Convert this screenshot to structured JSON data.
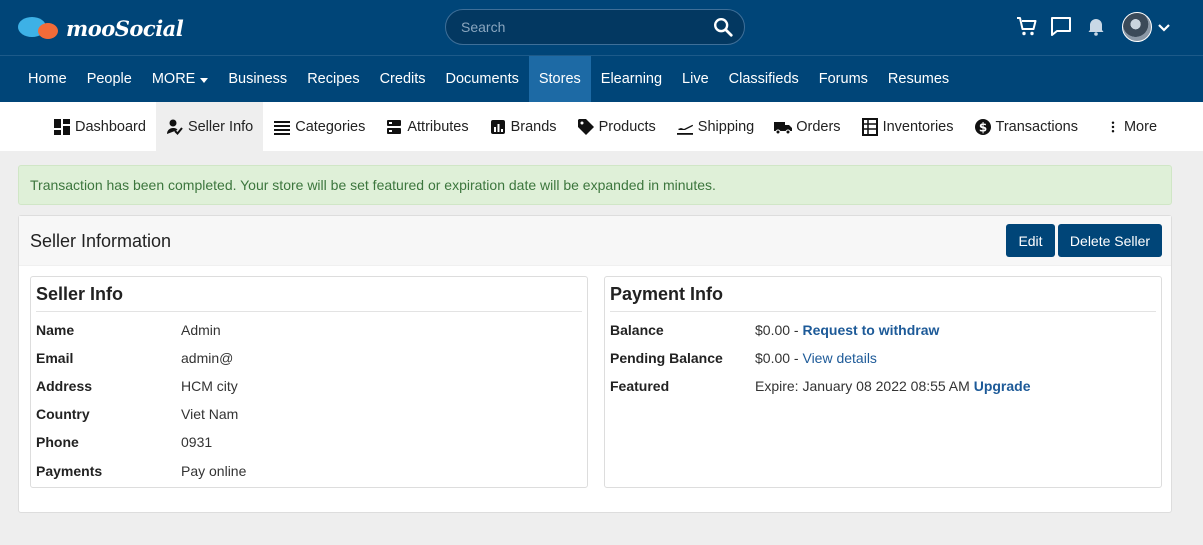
{
  "brand": {
    "name": "mooSocial"
  },
  "search": {
    "placeholder": "Search"
  },
  "main_nav": [
    {
      "label": "Home"
    },
    {
      "label": "People"
    },
    {
      "label": "MORE"
    },
    {
      "label": "Business"
    },
    {
      "label": "Recipes"
    },
    {
      "label": "Credits"
    },
    {
      "label": "Documents"
    },
    {
      "label": "Stores"
    },
    {
      "label": "Elearning"
    },
    {
      "label": "Live"
    },
    {
      "label": "Classifieds"
    },
    {
      "label": "Forums"
    },
    {
      "label": "Resumes"
    }
  ],
  "main_nav_active": "Stores",
  "sub_nav": [
    {
      "label": "Dashboard",
      "icon": "dashboard-icon"
    },
    {
      "label": "Seller Info",
      "icon": "user-check-icon"
    },
    {
      "label": "Categories",
      "icon": "list-icon"
    },
    {
      "label": "Attributes",
      "icon": "server-icon"
    },
    {
      "label": "Brands",
      "icon": "chart-icon"
    },
    {
      "label": "Products",
      "icon": "tag-icon"
    },
    {
      "label": "Shipping",
      "icon": "plane-icon"
    },
    {
      "label": "Orders",
      "icon": "truck-icon"
    },
    {
      "label": "Inventories",
      "icon": "inventory-icon"
    },
    {
      "label": "Transactions",
      "icon": "dollar-icon"
    },
    {
      "label": "More",
      "icon": "more-vertical-icon"
    }
  ],
  "sub_nav_active": "Seller Info",
  "alert": {
    "message": "Transaction has been completed. Your store will be set featured or expiration date will be expanded in minutes."
  },
  "panel": {
    "title": "Seller Information",
    "edit_label": "Edit",
    "delete_label": "Delete Seller"
  },
  "seller_info": {
    "title": "Seller Info",
    "rows": [
      {
        "label": "Name",
        "value": "Admin"
      },
      {
        "label": "Email",
        "value": "admin@"
      },
      {
        "label": "Address",
        "value": "HCM city"
      },
      {
        "label": "Country",
        "value": "Viet Nam"
      },
      {
        "label": "Phone",
        "value": "0931"
      },
      {
        "label": "Payments",
        "value": "Pay online"
      }
    ]
  },
  "payment_info": {
    "title": "Payment Info",
    "balance": {
      "label": "Balance",
      "value": "$0.00 - ",
      "link": "Request to withdraw"
    },
    "pending": {
      "label": "Pending Balance",
      "value": "$0.00 - ",
      "link": "View details"
    },
    "featured": {
      "label": "Featured",
      "value": "Expire: January 08 2022 08:55 AM ",
      "link": "Upgrade"
    }
  },
  "colors": {
    "header_bg": "#004578",
    "active_nav": "#1d6aa5",
    "link": "#1d5a98",
    "alert_bg": "#dff0d8",
    "alert_text": "#3c763d"
  }
}
